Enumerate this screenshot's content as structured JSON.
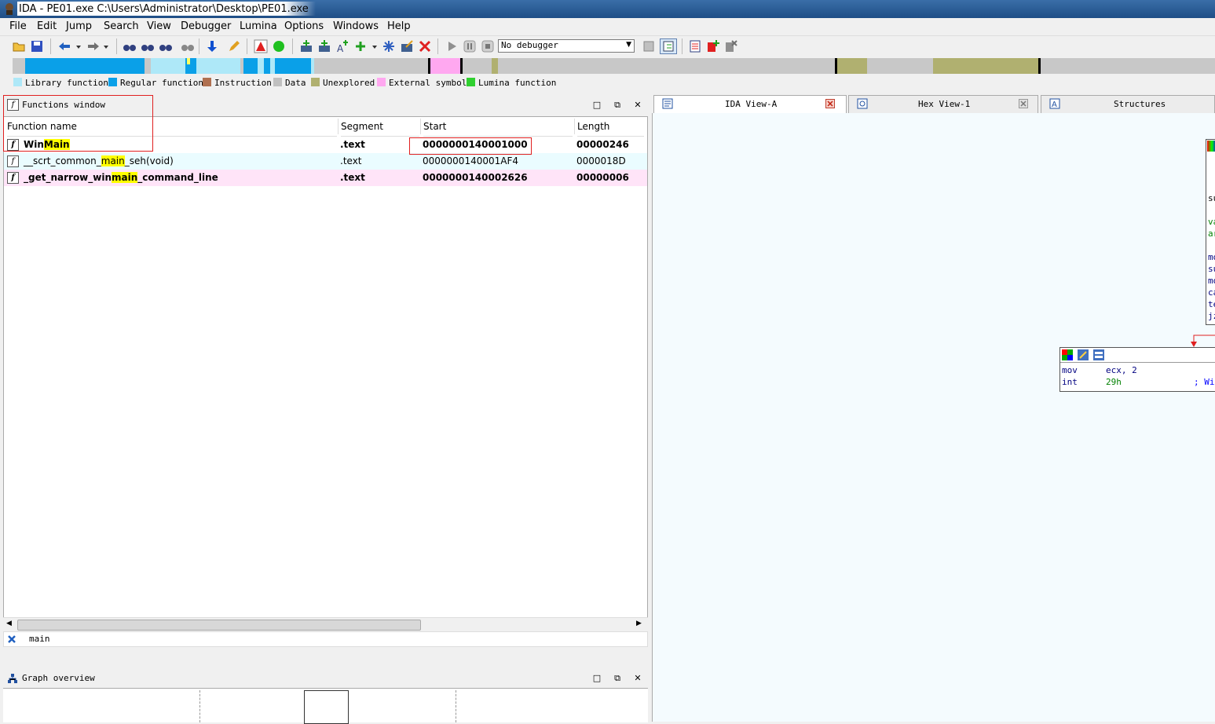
{
  "window": {
    "title": "IDA - PE01.exe C:\\Users\\Administrator\\Desktop\\PE01.exe"
  },
  "menu": [
    "File",
    "Edit",
    "Jump",
    "Search",
    "View",
    "Debugger",
    "Lumina",
    "Options",
    "Windows",
    "Help"
  ],
  "toolbar": {
    "debugger_select": "No debugger"
  },
  "legend": [
    {
      "label": "Library function",
      "color": "#aee8f8"
    },
    {
      "label": "Regular function",
      "color": "#0aa0e8"
    },
    {
      "label": "Instruction",
      "color": "#b07050"
    },
    {
      "label": "Data",
      "color": "#c0c0c0"
    },
    {
      "label": "Unexplored",
      "color": "#b0b070"
    },
    {
      "label": "External symbol",
      "color": "#ffa8f0"
    },
    {
      "label": "Lumina function",
      "color": "#30d030"
    }
  ],
  "functions_window": {
    "title": "Functions window",
    "columns": [
      "Function name",
      "Segment",
      "Start",
      "Length"
    ],
    "rows": [
      {
        "pre": "Win",
        "match": "Main",
        "post": "",
        "segment": ".text",
        "start": "0000000140001000",
        "length": "00000246",
        "bold": true,
        "bg": "#ffffff"
      },
      {
        "pre": "__scrt_common_",
        "match": "main",
        "post": "_seh(void)",
        "segment": ".text",
        "start": "0000000140001AF4",
        "length": "0000018D",
        "bold": false,
        "bg": "#eafcff"
      },
      {
        "pre": "_get_narrow_win",
        "match": "main",
        "post": "_command_line",
        "segment": ".text",
        "start": "0000000140002626",
        "length": "00000006",
        "bold": true,
        "bg": "#ffe4f8"
      }
    ],
    "filter": "main"
  },
  "graph_overview": {
    "title": "Graph overview"
  },
  "tabs": [
    {
      "label": "IDA View-A"
    },
    {
      "label": "Hex View-1"
    },
    {
      "label": "Structures"
    }
  ],
  "graph": {
    "node_main_lines": [
      "su",
      "va",
      "ar",
      "mo",
      "su",
      "mo",
      "ca",
      "te",
      "jz"
    ],
    "node2_lines": [
      {
        "mn": "mov",
        "op": "ecx, 2",
        "cm": ""
      },
      {
        "mn": "int",
        "op": "29h",
        "cm": "; Wi"
      }
    ]
  }
}
